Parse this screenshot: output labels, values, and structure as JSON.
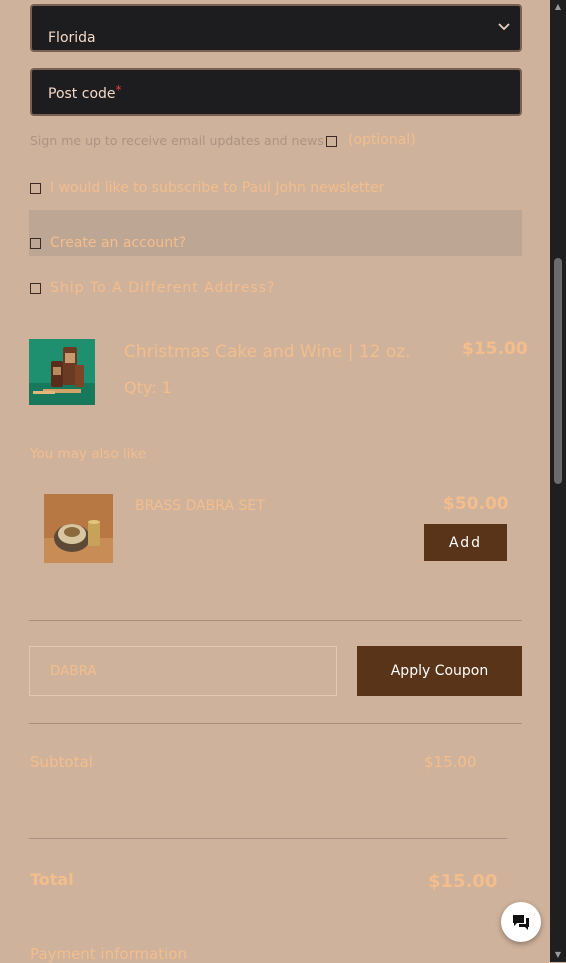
{
  "form": {
    "state_value": "Florida",
    "postcode_label": "Post code",
    "required_mark": "*",
    "email_updates_label": "Sign me up to receive email updates and news",
    "email_updates_optional": "(optional)",
    "newsletter_label": "I would like to subscribe to Paul John newsletter",
    "create_account_label": "Create an account?",
    "ship_different_label": "Ship To A Different Address?"
  },
  "cart": {
    "item_name": "Christmas Cake and Wine | 12 oz.",
    "item_qty": "Qty: 1",
    "item_price": "$15.00"
  },
  "upsell": {
    "heading": "You may also like",
    "product_name": "BRASS DABRA SET",
    "product_price": "$50.00",
    "add_label": "Add"
  },
  "coupon": {
    "input_value": "DABRA",
    "apply_label": "Apply Coupon"
  },
  "totals": {
    "subtotal_label": "Subtotal",
    "subtotal_value": "$15.00",
    "total_label": "Total",
    "total_value": "$15.00"
  },
  "payment": {
    "heading": "Payment information"
  },
  "colors": {
    "background": "#cfb29c",
    "field_bg": "#1d1c1e",
    "accent_orange": "#f3bd8c",
    "button_brown": "#5a3418"
  },
  "icons": {
    "select_arrow": "chevron-down-icon",
    "chat": "chat-bubble-icon"
  }
}
